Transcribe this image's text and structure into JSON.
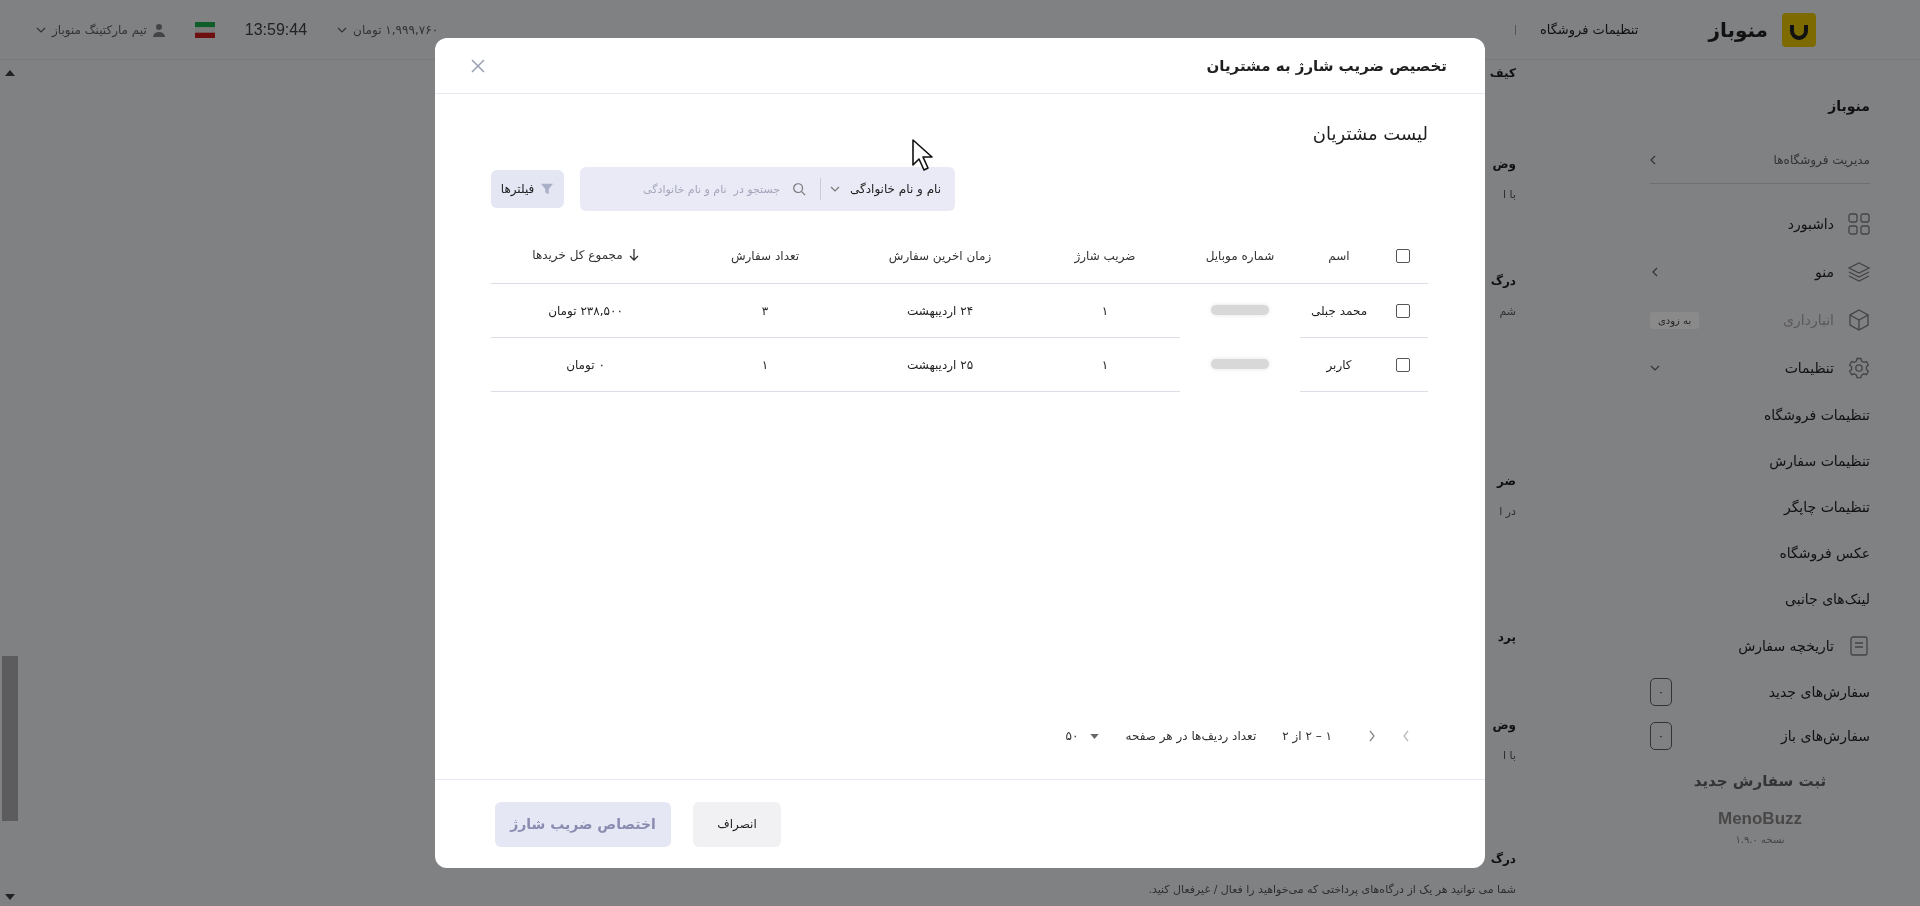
{
  "topbar": {
    "brand": "منوباز",
    "page_title": "تنظیمات فروشگاه",
    "balance": "۱,۹۹۹,۷۶۰ تومان",
    "clock": "13:59:44",
    "user": "تیم مارکتینگ منوباز"
  },
  "sidebar": {
    "title": "منوباز",
    "store_link": "مدیریت فروشگاه‌ها",
    "items": [
      {
        "label": "داشبورد",
        "kind": "dashboard",
        "disabled": false
      },
      {
        "label": "منو",
        "kind": "menu",
        "disabled": false,
        "expanded": false
      },
      {
        "label": "انبارداری",
        "kind": "inventory",
        "disabled": true,
        "badge": "به زودی"
      },
      {
        "label": "تنظیمات",
        "kind": "settings",
        "disabled": false,
        "expanded": true,
        "children": [
          {
            "label": "تنظیمات فروشگاه"
          },
          {
            "label": "تنظیمات سفارش"
          },
          {
            "label": "تنظیمات چاپگر"
          },
          {
            "label": "عکس فروشگاه"
          },
          {
            "label": "لینک‌های جانبی"
          }
        ]
      },
      {
        "label": "تاریخچه سفارش",
        "kind": "history",
        "disabled": false
      }
    ],
    "order_counts": [
      {
        "label": "سفارش‌های جدید",
        "count": "۰"
      },
      {
        "label": "سفارش‌های باز",
        "count": "۰"
      }
    ],
    "new_order_button": "ثبت سفارش جدید",
    "brand_mark": "MenoBuzz",
    "version": "نسخه ۱.۹.۰"
  },
  "content": {
    "sections": [
      {
        "title": "کیف"
      },
      {
        "title": "وض",
        "description": "با ا"
      },
      {
        "title": "درگ",
        "description": "شم"
      },
      {
        "title": "ضر",
        "description": "در ا"
      },
      {
        "title": "پرد"
      },
      {
        "title": "وض",
        "description": "با ا"
      },
      {
        "title": "درگ",
        "description": "شما می توانید هر یک از درگاه‌های پرداختی که می‌خواهید را فعال / غیرفعال کنید."
      }
    ]
  },
  "modal": {
    "title": "تخصیص ضریب شارژ به مشتریان",
    "section_title": "لیست مشتریان",
    "search": {
      "field": "نام و نام خانوادگی",
      "placeholder": "جستجو در  نام و نام خانوادگی"
    },
    "filter_button": "فیلترها",
    "table": {
      "select_all": {
        "checked": false
      },
      "columns": [
        {
          "label": "اسم",
          "sorted": false
        },
        {
          "label": "شماره موبایل",
          "sorted": false
        },
        {
          "label": "ضریب شارژ",
          "sorted": false
        },
        {
          "label": "زمان اخرین سفارش",
          "sorted": false
        },
        {
          "label": "تعداد سفارش",
          "sorted": false
        },
        {
          "label": "مجموع کل خریدها",
          "sorted": true
        }
      ],
      "rows": [
        {
          "checked": false,
          "name": "محمد جبلی",
          "charge_factor": "۱",
          "last_order": "۲۴ اردیبهشت",
          "order_count": "۳",
          "total": "۲۳۸,۵۰۰ تومان"
        },
        {
          "checked": false,
          "name": "کاربر",
          "charge_factor": "۱",
          "last_order": "۲۵ اردیبهشت",
          "order_count": "۱",
          "total": "۰ تومان"
        }
      ]
    },
    "pagination": {
      "range": "۱ – ۲ از ۲",
      "rows_per_page_label": "تعداد ردیف‌ها در هر صفحه",
      "rows_per_page": "۵۰"
    },
    "cancel_button": "انصراف",
    "submit_button": {
      "label": "اختصاص ضریب شارژ",
      "disabled": true
    }
  }
}
